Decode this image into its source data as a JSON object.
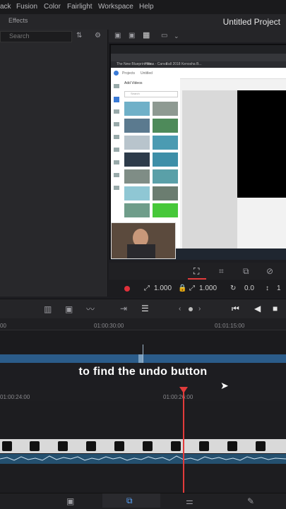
{
  "menubar": {
    "items": [
      "ack",
      "Fusion",
      "Color",
      "Fairlight",
      "Workspace",
      "Help"
    ]
  },
  "project": {
    "title": "Untitled Project",
    "title_right_fragment": "Ti"
  },
  "media_panel": {
    "effects_label": "Effects",
    "search_placeholder": "Search"
  },
  "browser_preview": {
    "bookmarks": [
      "The New Blueprint Ma...",
      "Home - Canva",
      "Fall 2018 Kenosha B..."
    ],
    "app_section": "Add Videos",
    "search_placeholder": "Search",
    "project_crumbs": [
      "Projects",
      "Untitled"
    ]
  },
  "viewer_controls": {
    "zoom_x": "1.000",
    "zoom_y": "1.000",
    "rotation": "0.0",
    "extra": "1"
  },
  "timeline": {
    "ruler1_labels": [
      "00",
      "01:00:30:00",
      "01:01:15:00"
    ],
    "ruler2_labels": [
      "01:00:24:00",
      "01:00:26:00"
    ],
    "caption": "to find the undo button"
  },
  "colors": {
    "accent_blue": "#2b5c8a",
    "playhead_red": "#e23b3b",
    "record_red": "#e0303a"
  }
}
